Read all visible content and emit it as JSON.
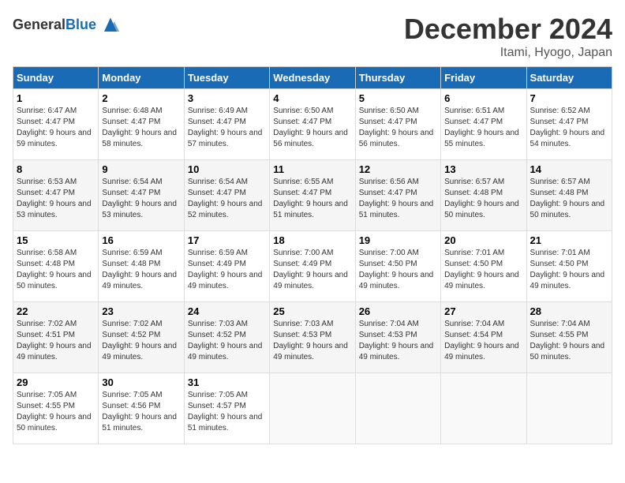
{
  "header": {
    "logo_general": "General",
    "logo_blue": "Blue",
    "title": "December 2024",
    "location": "Itami, Hyogo, Japan"
  },
  "weekdays": [
    "Sunday",
    "Monday",
    "Tuesday",
    "Wednesday",
    "Thursday",
    "Friday",
    "Saturday"
  ],
  "weeks": [
    [
      {
        "day": "1",
        "sunrise": "6:47 AM",
        "sunset": "4:47 PM",
        "daylight": "9 hours and 59 minutes."
      },
      {
        "day": "2",
        "sunrise": "6:48 AM",
        "sunset": "4:47 PM",
        "daylight": "9 hours and 58 minutes."
      },
      {
        "day": "3",
        "sunrise": "6:49 AM",
        "sunset": "4:47 PM",
        "daylight": "9 hours and 57 minutes."
      },
      {
        "day": "4",
        "sunrise": "6:50 AM",
        "sunset": "4:47 PM",
        "daylight": "9 hours and 56 minutes."
      },
      {
        "day": "5",
        "sunrise": "6:50 AM",
        "sunset": "4:47 PM",
        "daylight": "9 hours and 56 minutes."
      },
      {
        "day": "6",
        "sunrise": "6:51 AM",
        "sunset": "4:47 PM",
        "daylight": "9 hours and 55 minutes."
      },
      {
        "day": "7",
        "sunrise": "6:52 AM",
        "sunset": "4:47 PM",
        "daylight": "9 hours and 54 minutes."
      }
    ],
    [
      {
        "day": "8",
        "sunrise": "6:53 AM",
        "sunset": "4:47 PM",
        "daylight": "9 hours and 53 minutes."
      },
      {
        "day": "9",
        "sunrise": "6:54 AM",
        "sunset": "4:47 PM",
        "daylight": "9 hours and 53 minutes."
      },
      {
        "day": "10",
        "sunrise": "6:54 AM",
        "sunset": "4:47 PM",
        "daylight": "9 hours and 52 minutes."
      },
      {
        "day": "11",
        "sunrise": "6:55 AM",
        "sunset": "4:47 PM",
        "daylight": "9 hours and 51 minutes."
      },
      {
        "day": "12",
        "sunrise": "6:56 AM",
        "sunset": "4:47 PM",
        "daylight": "9 hours and 51 minutes."
      },
      {
        "day": "13",
        "sunrise": "6:57 AM",
        "sunset": "4:48 PM",
        "daylight": "9 hours and 50 minutes."
      },
      {
        "day": "14",
        "sunrise": "6:57 AM",
        "sunset": "4:48 PM",
        "daylight": "9 hours and 50 minutes."
      }
    ],
    [
      {
        "day": "15",
        "sunrise": "6:58 AM",
        "sunset": "4:48 PM",
        "daylight": "9 hours and 50 minutes."
      },
      {
        "day": "16",
        "sunrise": "6:59 AM",
        "sunset": "4:48 PM",
        "daylight": "9 hours and 49 minutes."
      },
      {
        "day": "17",
        "sunrise": "6:59 AM",
        "sunset": "4:49 PM",
        "daylight": "9 hours and 49 minutes."
      },
      {
        "day": "18",
        "sunrise": "7:00 AM",
        "sunset": "4:49 PM",
        "daylight": "9 hours and 49 minutes."
      },
      {
        "day": "19",
        "sunrise": "7:00 AM",
        "sunset": "4:50 PM",
        "daylight": "9 hours and 49 minutes."
      },
      {
        "day": "20",
        "sunrise": "7:01 AM",
        "sunset": "4:50 PM",
        "daylight": "9 hours and 49 minutes."
      },
      {
        "day": "21",
        "sunrise": "7:01 AM",
        "sunset": "4:50 PM",
        "daylight": "9 hours and 49 minutes."
      }
    ],
    [
      {
        "day": "22",
        "sunrise": "7:02 AM",
        "sunset": "4:51 PM",
        "daylight": "9 hours and 49 minutes."
      },
      {
        "day": "23",
        "sunrise": "7:02 AM",
        "sunset": "4:52 PM",
        "daylight": "9 hours and 49 minutes."
      },
      {
        "day": "24",
        "sunrise": "7:03 AM",
        "sunset": "4:52 PM",
        "daylight": "9 hours and 49 minutes."
      },
      {
        "day": "25",
        "sunrise": "7:03 AM",
        "sunset": "4:53 PM",
        "daylight": "9 hours and 49 minutes."
      },
      {
        "day": "26",
        "sunrise": "7:04 AM",
        "sunset": "4:53 PM",
        "daylight": "9 hours and 49 minutes."
      },
      {
        "day": "27",
        "sunrise": "7:04 AM",
        "sunset": "4:54 PM",
        "daylight": "9 hours and 49 minutes."
      },
      {
        "day": "28",
        "sunrise": "7:04 AM",
        "sunset": "4:55 PM",
        "daylight": "9 hours and 50 minutes."
      }
    ],
    [
      {
        "day": "29",
        "sunrise": "7:05 AM",
        "sunset": "4:55 PM",
        "daylight": "9 hours and 50 minutes."
      },
      {
        "day": "30",
        "sunrise": "7:05 AM",
        "sunset": "4:56 PM",
        "daylight": "9 hours and 51 minutes."
      },
      {
        "day": "31",
        "sunrise": "7:05 AM",
        "sunset": "4:57 PM",
        "daylight": "9 hours and 51 minutes."
      },
      null,
      null,
      null,
      null
    ]
  ],
  "labels": {
    "sunrise": "Sunrise: ",
    "sunset": "Sunset: ",
    "daylight": "Daylight: "
  }
}
